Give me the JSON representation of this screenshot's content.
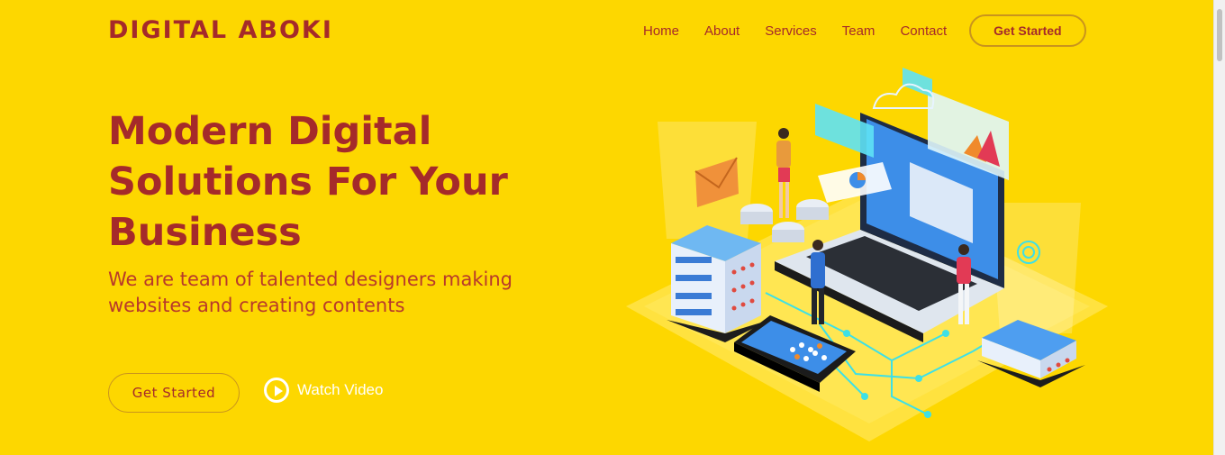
{
  "brand": {
    "name": "DIGITAL ABOKI"
  },
  "nav": {
    "items": [
      {
        "label": "Home"
      },
      {
        "label": "About"
      },
      {
        "label": "Services"
      },
      {
        "label": "Team"
      },
      {
        "label": "Contact"
      }
    ],
    "cta_label": "Get Started"
  },
  "hero": {
    "title_line1": "Modern Digital",
    "title_line2": "Solutions For Your",
    "title_line3": "Business",
    "subtitle_line1": "We are team of talented designers making",
    "subtitle_line2": "websites and creating contents",
    "primary_button": "Get Started",
    "video_link": "Watch Video"
  },
  "colors": {
    "background": "#fdd700",
    "brand": "#a52a2a",
    "button_border": "#c9941d",
    "white": "#ffffff"
  },
  "icons": {
    "play": "play-circle-icon"
  }
}
